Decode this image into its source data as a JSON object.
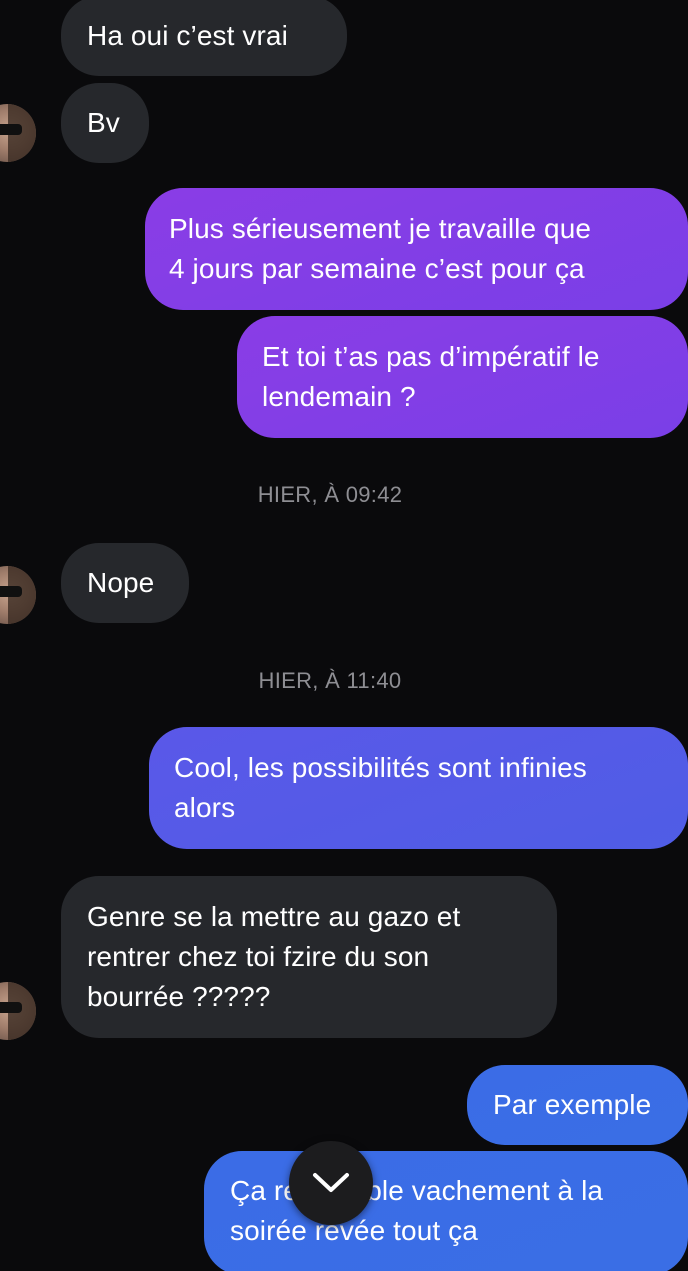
{
  "messages": [
    {
      "id": "m1",
      "direction": "received",
      "text": "Ha oui c’est vrai"
    },
    {
      "id": "m2",
      "direction": "received",
      "text": "Bv"
    },
    {
      "id": "m3",
      "direction": "sent",
      "text": "Plus sérieusement je travaille que\n4 jours par semaine c’est pour ça"
    },
    {
      "id": "m4",
      "direction": "sent",
      "text": "Et toi t’as pas d’impératif le\nlendemain ?"
    },
    {
      "id": "m5",
      "direction": "received",
      "text": "Nope"
    },
    {
      "id": "m6",
      "direction": "sent",
      "text": "Cool, les possibilités sont infinies\nalors"
    },
    {
      "id": "m7",
      "direction": "received",
      "text": "Genre se la mettre au gazo et\nrentrer chez toi fzire du son\nbourrée ?????"
    },
    {
      "id": "m8",
      "direction": "sent",
      "text": "Par exemple"
    },
    {
      "id": "m9",
      "direction": "sent",
      "text": "Ça ressemble vachement à la\nsoirée rêvée tout ça"
    }
  ],
  "timestamps": [
    "HIER, À 09:42",
    "HIER, À 11:40"
  ],
  "scroll_button": {
    "icon": "chevron-down-icon"
  },
  "colors": {
    "background": "#0a0a0c",
    "received_bubble": "#26282c",
    "sent_purple": "#8a3de6",
    "sent_indigo": "#5a58e8",
    "sent_blue": "#3b6ce6",
    "timestamp_text": "#8e8e93"
  }
}
